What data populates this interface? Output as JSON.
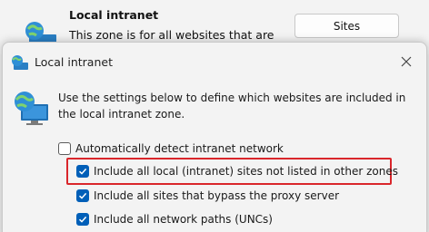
{
  "background": {
    "zone_title": "Local intranet",
    "zone_description": "This zone is for all websites that are",
    "sites_button_label": "Sites"
  },
  "dialog": {
    "title": "Local intranet",
    "instruction": "Use the settings below to define which websites are included in the local intranet zone.",
    "options": {
      "auto_detect": {
        "label": "Automatically detect intranet network",
        "checked": false
      },
      "include_local": {
        "label": "Include all local (intranet) sites not listed in other zones",
        "checked": true
      },
      "include_proxy_bypass": {
        "label": "Include all sites that bypass the proxy server",
        "checked": true
      },
      "include_unc": {
        "label": "Include all network paths (UNCs)",
        "checked": true
      }
    }
  },
  "colors": {
    "checkbox_checked": "#005fb8",
    "highlight": "#d9262b"
  },
  "icons": {
    "zone": "globe-monitor-icon",
    "close": "close-icon",
    "check": "checkmark-icon"
  }
}
